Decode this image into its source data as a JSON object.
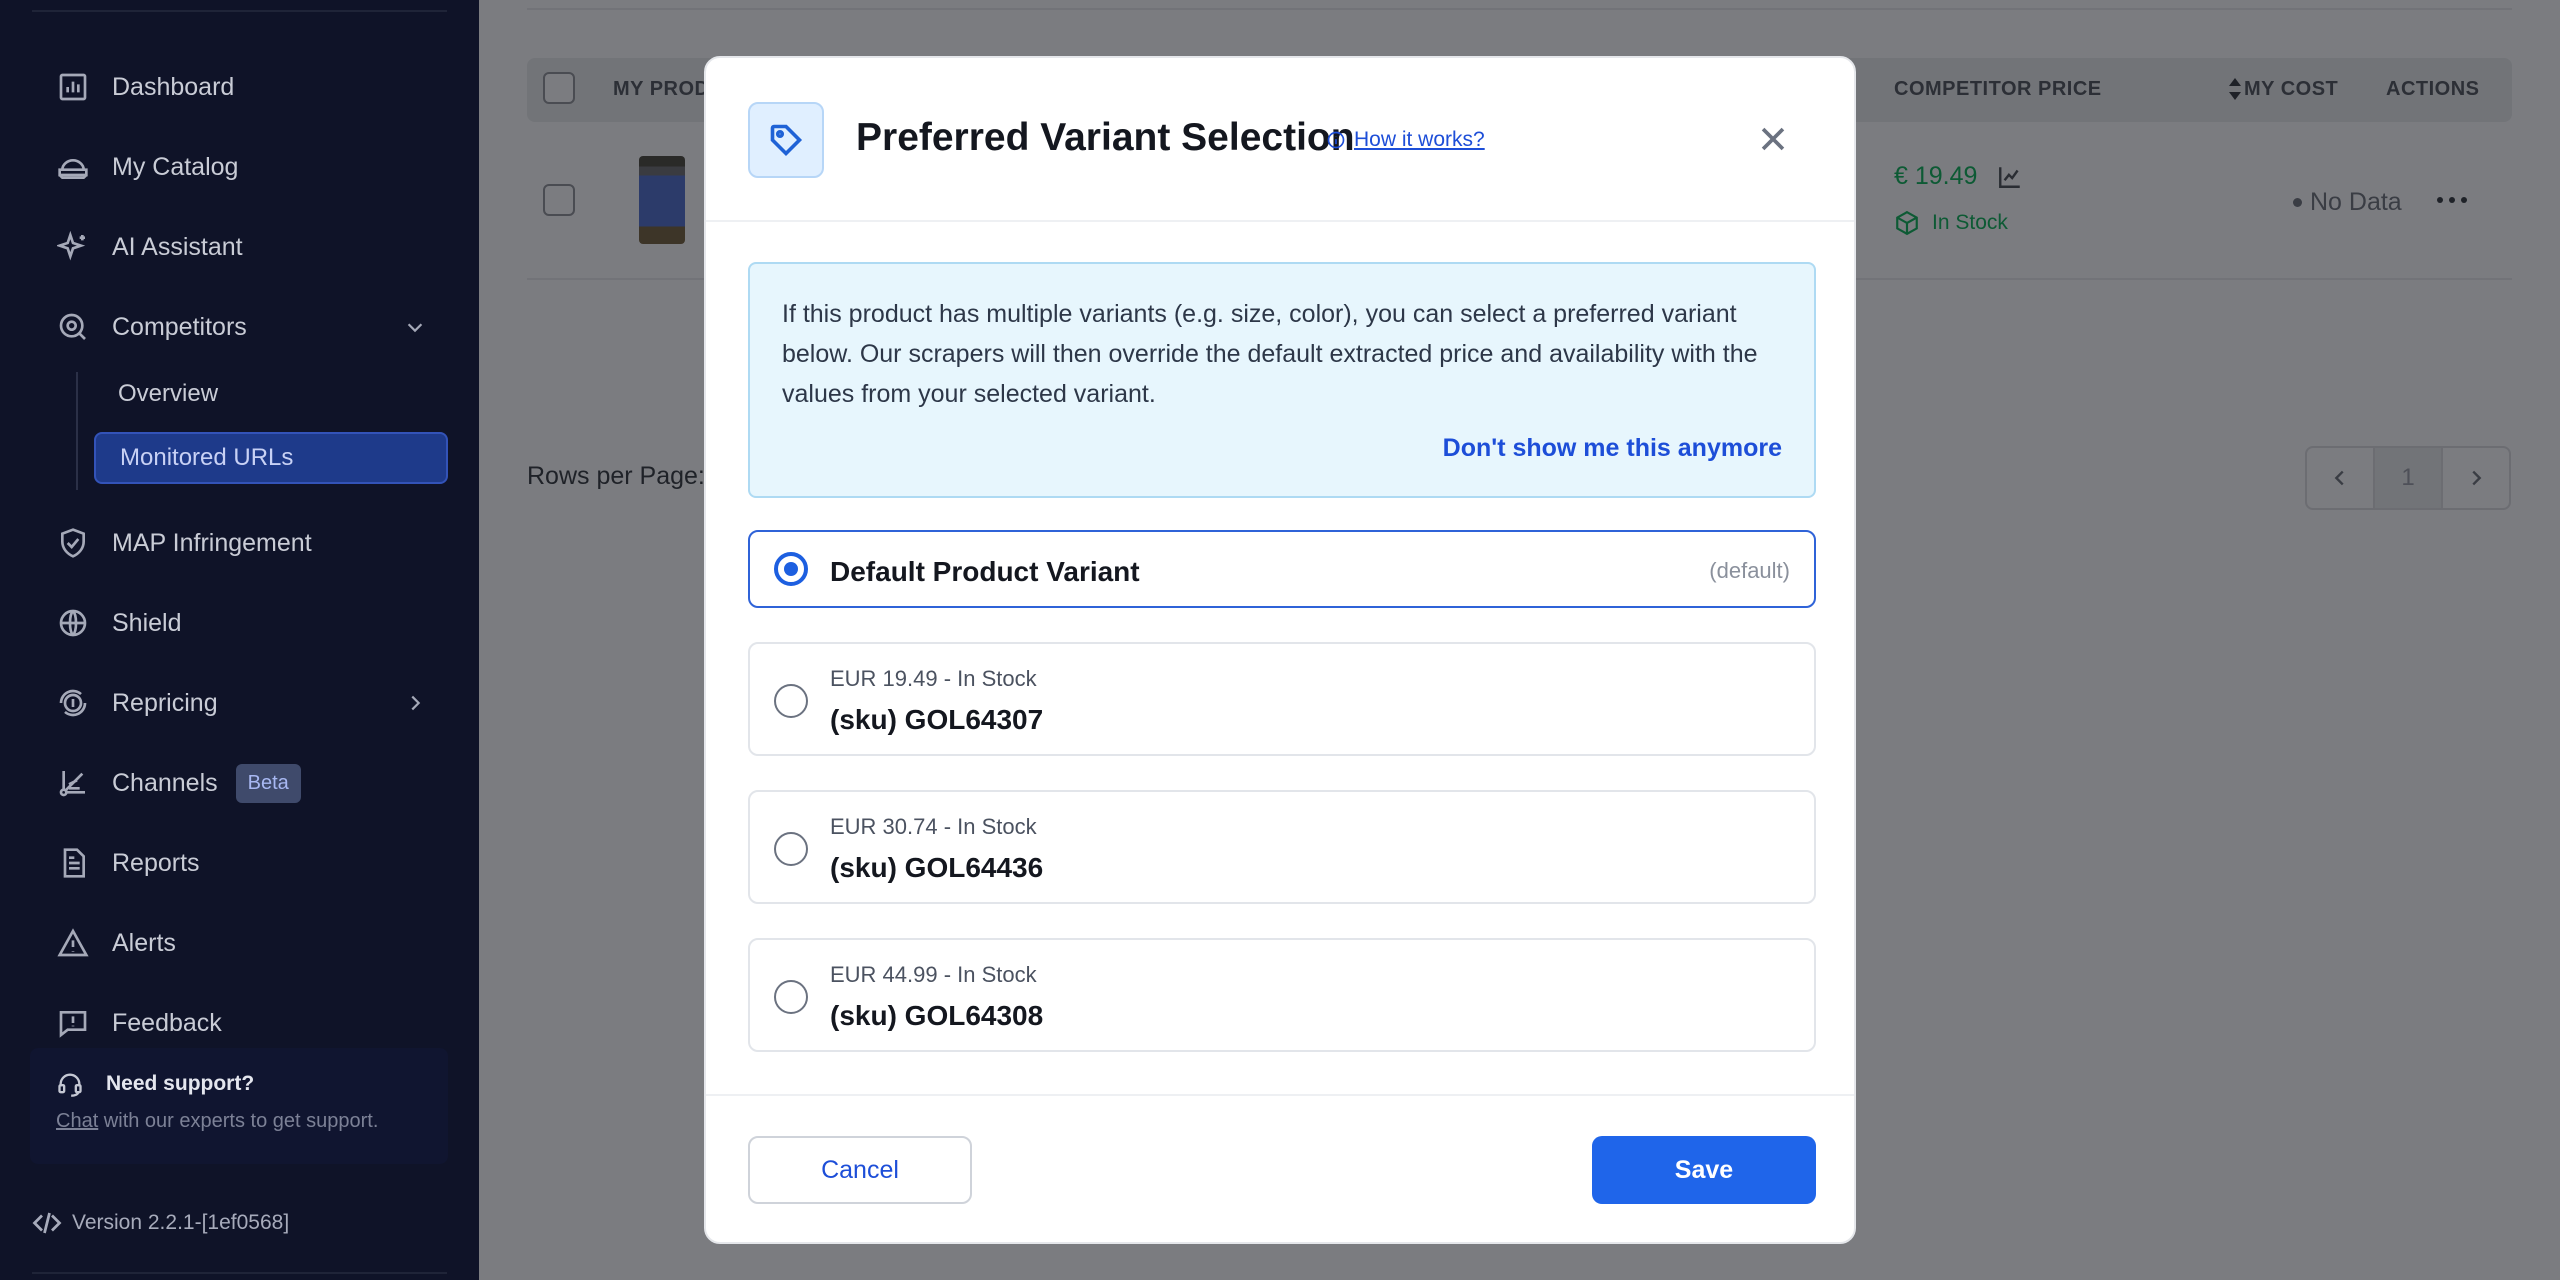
{
  "sidebar": {
    "items": [
      {
        "label": "Dashboard",
        "icon": "chart-icon"
      },
      {
        "label": "My Catalog",
        "icon": "catalog-icon"
      },
      {
        "label": "AI Assistant",
        "icon": "sparkle-icon"
      },
      {
        "label": "Competitors",
        "icon": "competitors-icon"
      },
      {
        "label": "MAP Infringement",
        "icon": "shield-check-icon"
      },
      {
        "label": "Shield",
        "icon": "globe-icon"
      },
      {
        "label": "Repricing",
        "icon": "repricing-icon"
      },
      {
        "label": "Channels",
        "icon": "channels-icon"
      },
      {
        "label": "Reports",
        "icon": "report-icon"
      },
      {
        "label": "Alerts",
        "icon": "alert-icon"
      },
      {
        "label": "Feedback",
        "icon": "feedback-icon"
      }
    ],
    "competitors_sub": [
      {
        "label": "Overview",
        "active": false
      },
      {
        "label": "Monitored URLs",
        "active": true
      }
    ],
    "channels_badge": "Beta",
    "support": {
      "title": "Need support?",
      "link": "Chat",
      "text": " with our experts to get support."
    },
    "version": "Version 2.2.1-[1ef0568]"
  },
  "table": {
    "headers": {
      "my_product": "MY PROD",
      "competitor_price": "COMPETITOR PRICE",
      "my_cost": "MY COST",
      "actions": "ACTIONS"
    },
    "row": {
      "price": "€ 19.49",
      "stock": "In Stock",
      "cost": "No Data"
    },
    "rows_per_page_label": "Rows per Page:",
    "page": "1"
  },
  "modal": {
    "title": "Preferred Variant Selection",
    "how_it_works": "How it works?",
    "info_text": "If this product has multiple variants (e.g. size, color), you can select a preferred variant below. Our scrapers will then override the default extracted price and availability with the values from your selected variant.",
    "dont_show": "Don't show me this anymore",
    "default_option": {
      "label": "Default Product Variant",
      "tag": "(default)"
    },
    "options": [
      {
        "sub": "EUR 19.49 - In Stock",
        "sku": "(sku) GOL64307"
      },
      {
        "sub": "EUR 30.74 - In Stock",
        "sku": "(sku) GOL64436"
      },
      {
        "sub": "EUR 44.99 - In Stock",
        "sku": "(sku) GOL64308"
      }
    ],
    "cancel": "Cancel",
    "save": "Save"
  },
  "colors": {
    "primary": "#1f65ea",
    "sidebar_bg": "#0f1328",
    "stock_green": "#0d5a34",
    "info_bg": "#e7f6fd"
  }
}
